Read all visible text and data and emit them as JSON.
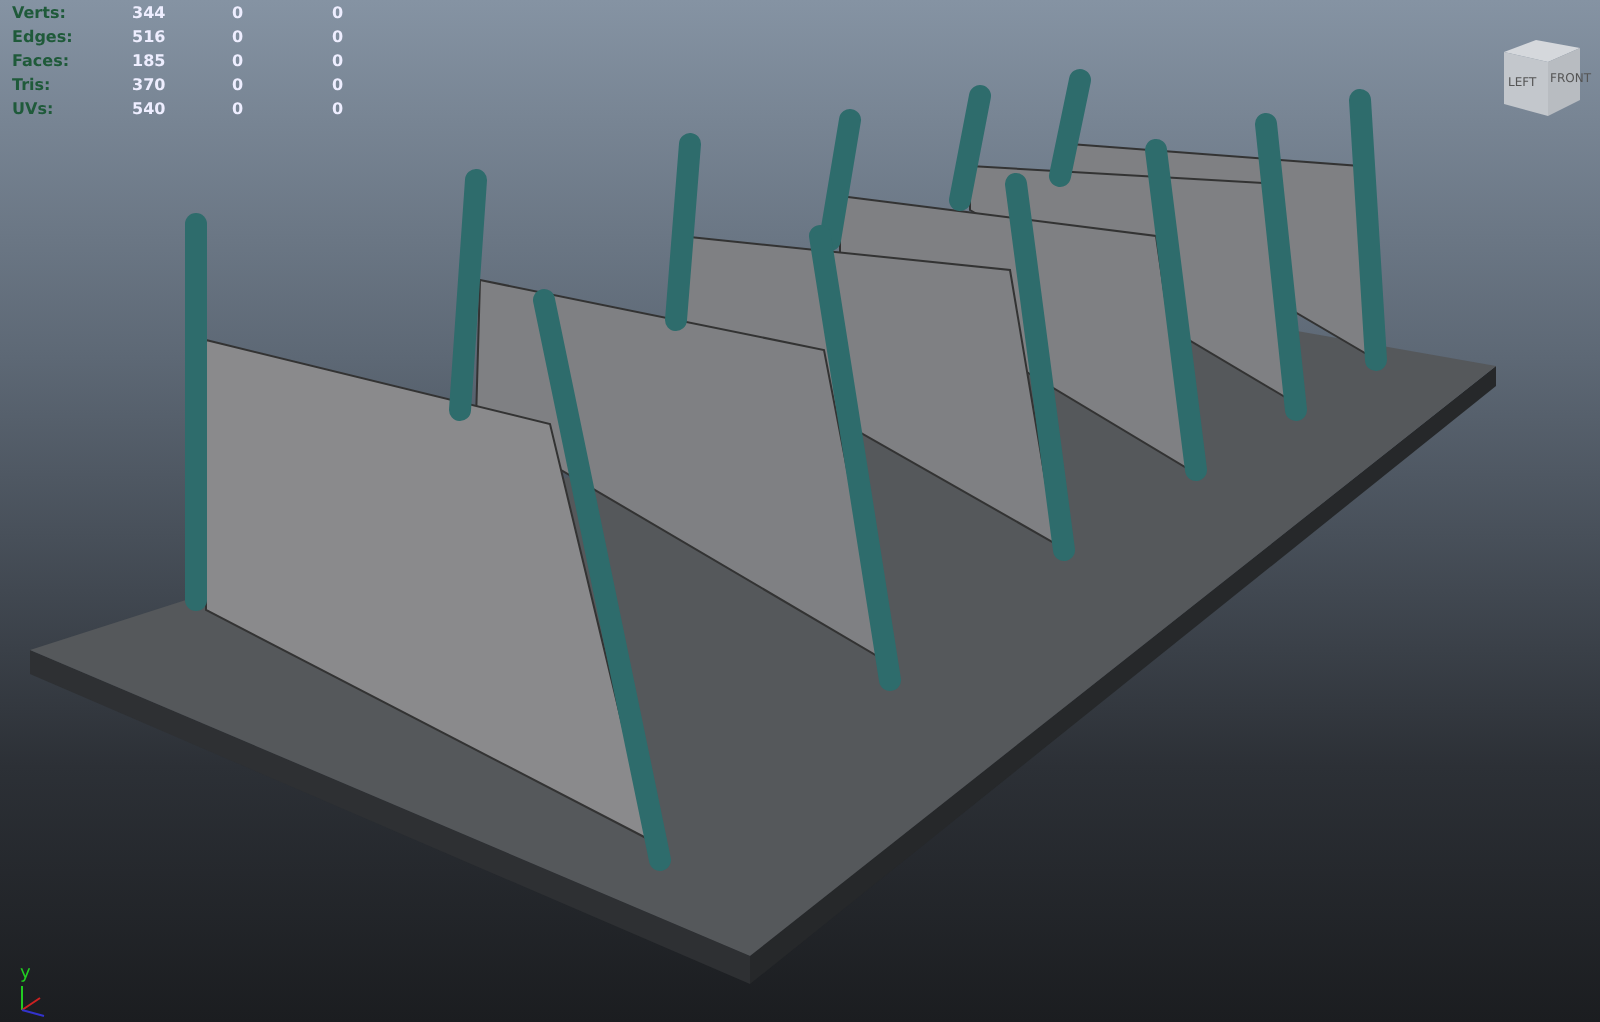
{
  "hud_stats": [
    {
      "label": "Verts:",
      "values": [
        "344",
        "0",
        "0"
      ]
    },
    {
      "label": "Edges:",
      "values": [
        "516",
        "0",
        "0"
      ]
    },
    {
      "label": "Faces:",
      "values": [
        "185",
        "0",
        "0"
      ]
    },
    {
      "label": "Tris:",
      "values": [
        "370",
        "0",
        "0"
      ]
    },
    {
      "label": "UVs:",
      "values": [
        "540",
        "0",
        "0"
      ]
    }
  ],
  "view_cube": {
    "left_face": "LEFT",
    "front_face": "FRONT"
  },
  "axis_gizmo": {
    "up_label": "y"
  }
}
